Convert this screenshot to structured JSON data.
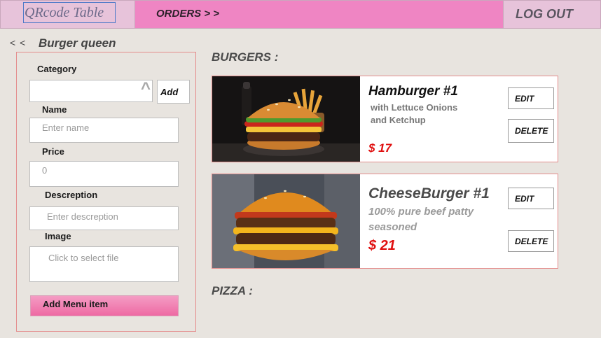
{
  "header": {
    "brand": "QRcode Table",
    "orders_label": "ORDERS > >",
    "logout_label": "LOG OUT"
  },
  "nav": {
    "back": "< <",
    "restaurant_name": "Burger queen"
  },
  "form": {
    "category_label": "Category",
    "category_value": "",
    "add_category_label": "Add",
    "name_label": "Name",
    "name_placeholder": "Enter name",
    "price_label": "Price",
    "price_placeholder": "0",
    "description_label": "Descreption",
    "description_placeholder": "Enter descreption",
    "image_label": "Image",
    "image_placeholder": "Click to select file",
    "submit_label": "Add Menu item"
  },
  "sections": {
    "burgers_title": "BURGERS :",
    "pizza_title": "PIZZA :"
  },
  "items": [
    {
      "name": "Hamburger #1",
      "description_line1": "with Lettuce Onions",
      "description_line2": "and Ketchup",
      "price": "$ 17",
      "edit_label": "EDIT",
      "delete_label": "DELETE"
    },
    {
      "name": "CheeseBurger #1",
      "description_line1": "100% pure beef patty",
      "description_line2": "seasoned",
      "price": "$ 21",
      "edit_label": "EDIT",
      "delete_label": "DELETE"
    }
  ],
  "icons": {
    "category_dropdown": "chevron-up-icon"
  },
  "colors": {
    "accent_pink": "#ef85c3",
    "price_red": "#e01010",
    "panel_border": "#e48c8c"
  }
}
